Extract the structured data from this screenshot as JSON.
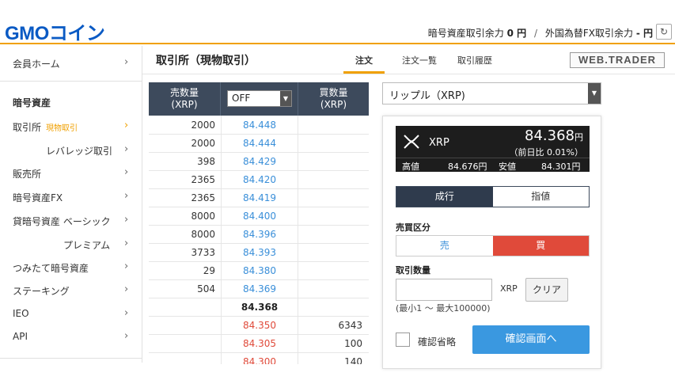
{
  "header": {
    "logo": "GMOコイン",
    "crypto_margin_label": "暗号資産取引余力",
    "crypto_margin_value": "0 円",
    "separator": "/",
    "fx_margin_label": "外国為替FX取引余力",
    "fx_margin_value": "- 円",
    "refresh_glyph": "↻"
  },
  "sidebar": {
    "member_home": "会員ホーム",
    "section_crypto": "暗号資産",
    "exchange": "取引所",
    "exchange_sub": "現物取引",
    "leverage": "レバレッジ取引",
    "sales": "販売所",
    "crypto_fx": "暗号資産FX",
    "lending_basic": "貸暗号資産 ベーシック",
    "premium": "プレミアム",
    "tsumitate": "つみたて暗号資産",
    "staking": "ステーキング",
    "ieo": "IEO",
    "api": "API",
    "chevron": "›"
  },
  "page": {
    "title": "取引所（現物取引）",
    "tabs": [
      "注文",
      "注文一覧",
      "取引履歴"
    ],
    "active_tab": 0,
    "trader_logo": "WEB.TRADER"
  },
  "orderbook": {
    "ask_header": "売数量\n(XRP)",
    "bid_header": "買数量\n(XRP)",
    "filter_value": "OFF",
    "asks": [
      {
        "qty": "2000",
        "price": "84.448"
      },
      {
        "qty": "2000",
        "price": "84.444"
      },
      {
        "qty": "398",
        "price": "84.429"
      },
      {
        "qty": "2365",
        "price": "84.420"
      },
      {
        "qty": "2365",
        "price": "84.419"
      },
      {
        "qty": "8000",
        "price": "84.400"
      },
      {
        "qty": "8000",
        "price": "84.396"
      },
      {
        "qty": "3733",
        "price": "84.393"
      },
      {
        "qty": "29",
        "price": "84.380"
      },
      {
        "qty": "504",
        "price": "84.369"
      }
    ],
    "mid_price": "84.368",
    "bids": [
      {
        "price": "84.350",
        "qty": "6343"
      },
      {
        "price": "84.305",
        "qty": "100"
      },
      {
        "price": "84.300",
        "qty": "140"
      }
    ]
  },
  "pair": {
    "selected": "リップル（XRP)"
  },
  "ticker": {
    "symbol": "XRP",
    "last": "84.368",
    "last_unit": "円",
    "change": "（前日比 0.01%）",
    "high_label": "高値",
    "high_value": "84.676円",
    "low_label": "安値",
    "low_value": "84.301円"
  },
  "order": {
    "type_market": "成行",
    "type_limit": "指値",
    "side_label": "売買区分",
    "side_sell": "売",
    "side_buy": "買",
    "qty_label": "取引数量",
    "qty_value": "",
    "qty_unit": "XRP",
    "clear": "クリア",
    "qty_hint": "(最小1 ～ 最大100000)",
    "skip_confirm": "確認省略",
    "confirm": "確認画面へ"
  },
  "colors": {
    "accent": "#f0a000",
    "ask_price": "#3a8fd9",
    "bid_price": "#e04a3a",
    "header_dark": "#3d4a5c",
    "confirm": "#3a98e0"
  }
}
